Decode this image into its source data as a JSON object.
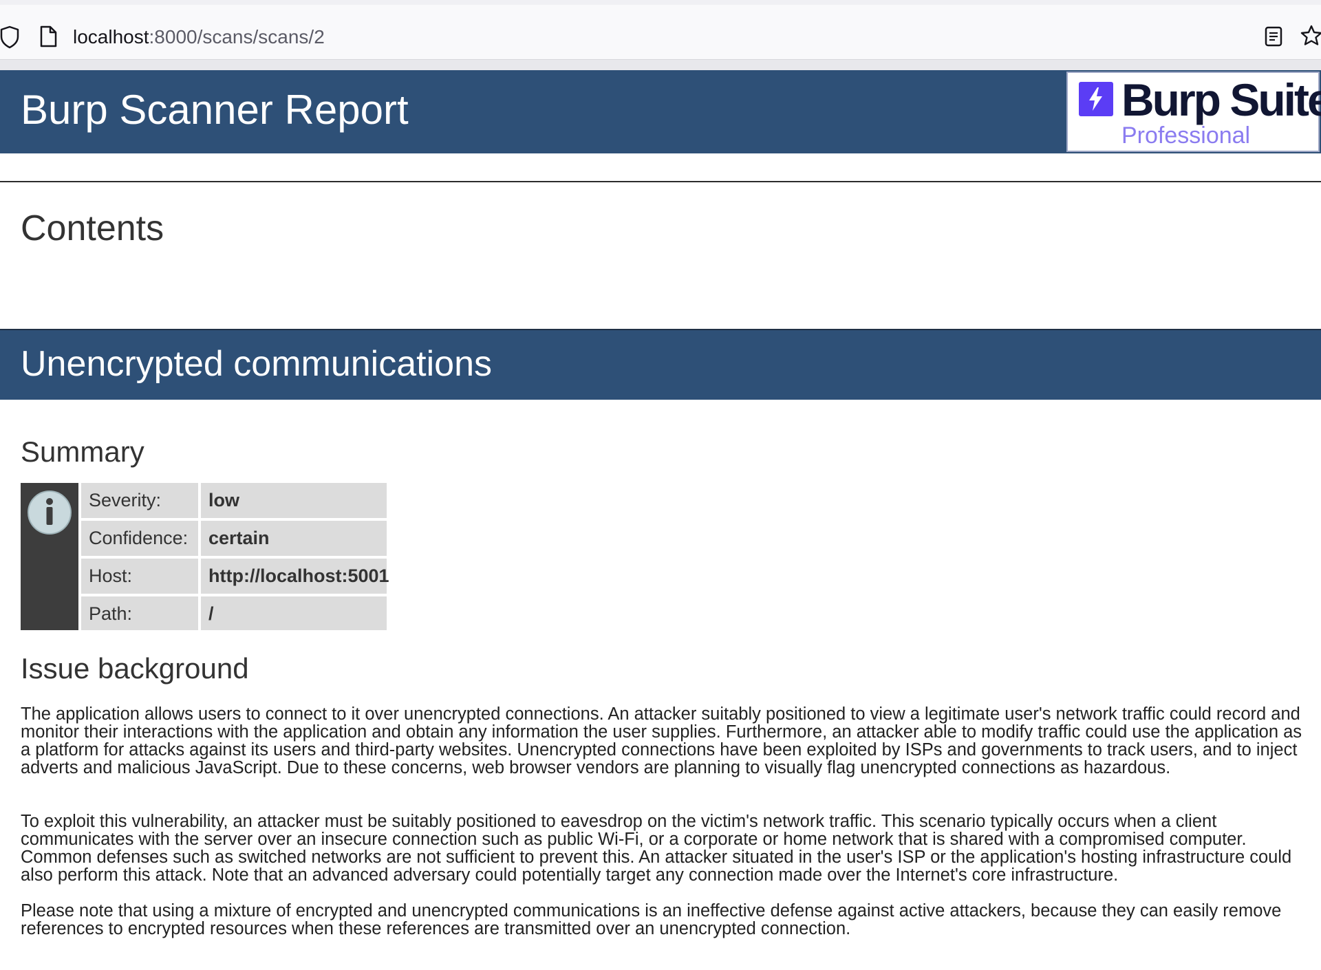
{
  "browser": {
    "url_host": "localhost",
    "url_rest": ":8000/scans/scans/2",
    "icons": {
      "security": "shield-icon",
      "page": "page-icon",
      "reader": "reader-view-icon",
      "bookmark": "star-icon"
    }
  },
  "report": {
    "title": "Burp Scanner Report",
    "logo": {
      "name": "Burp Suite",
      "edition": "Professional",
      "mark_color": "#5b3df5"
    },
    "header_color": "#2e5077"
  },
  "contents": {
    "heading": "Contents"
  },
  "issue": {
    "title": "Unencrypted communications",
    "summary_heading": "Summary",
    "summary_icon": "info-icon",
    "summary": [
      {
        "label": "Severity:",
        "value": "low"
      },
      {
        "label": "Confidence:",
        "value": "certain"
      },
      {
        "label": "Host:",
        "value": "http://localhost:5001"
      },
      {
        "label": "Path:",
        "value": "/"
      }
    ],
    "background_heading": "Issue background",
    "background_paragraphs": [
      "The application allows users to connect to it over unencrypted connections. An attacker suitably positioned to view a legitimate user's network traffic could record and monitor their interactions with the application and obtain any information the user supplies. Furthermore, an attacker able to modify traffic could use the application as a platform for attacks against its users and third-party websites. Unencrypted connections have been exploited by ISPs and governments to track users, and to inject adverts and malicious JavaScript. Due to these concerns, web browser vendors are planning to visually flag unencrypted connections as hazardous.",
      "To exploit this vulnerability, an attacker must be suitably positioned to eavesdrop on the victim's network traffic. This scenario typically occurs when a client communicates with the server over an insecure connection such as public Wi-Fi, or a corporate or home network that is shared with a compromised computer. Common defenses such as switched networks are not sufficient to prevent this. An attacker situated in the user's ISP or the application's hosting infrastructure could also perform this attack. Note that an advanced adversary could potentially target any connection made over the Internet's core infrastructure.",
      "Please note that using a mixture of encrypted and unencrypted communications is an ineffective defense against active attackers, because they can easily remove references to encrypted resources when these references are transmitted over an unencrypted connection."
    ]
  }
}
